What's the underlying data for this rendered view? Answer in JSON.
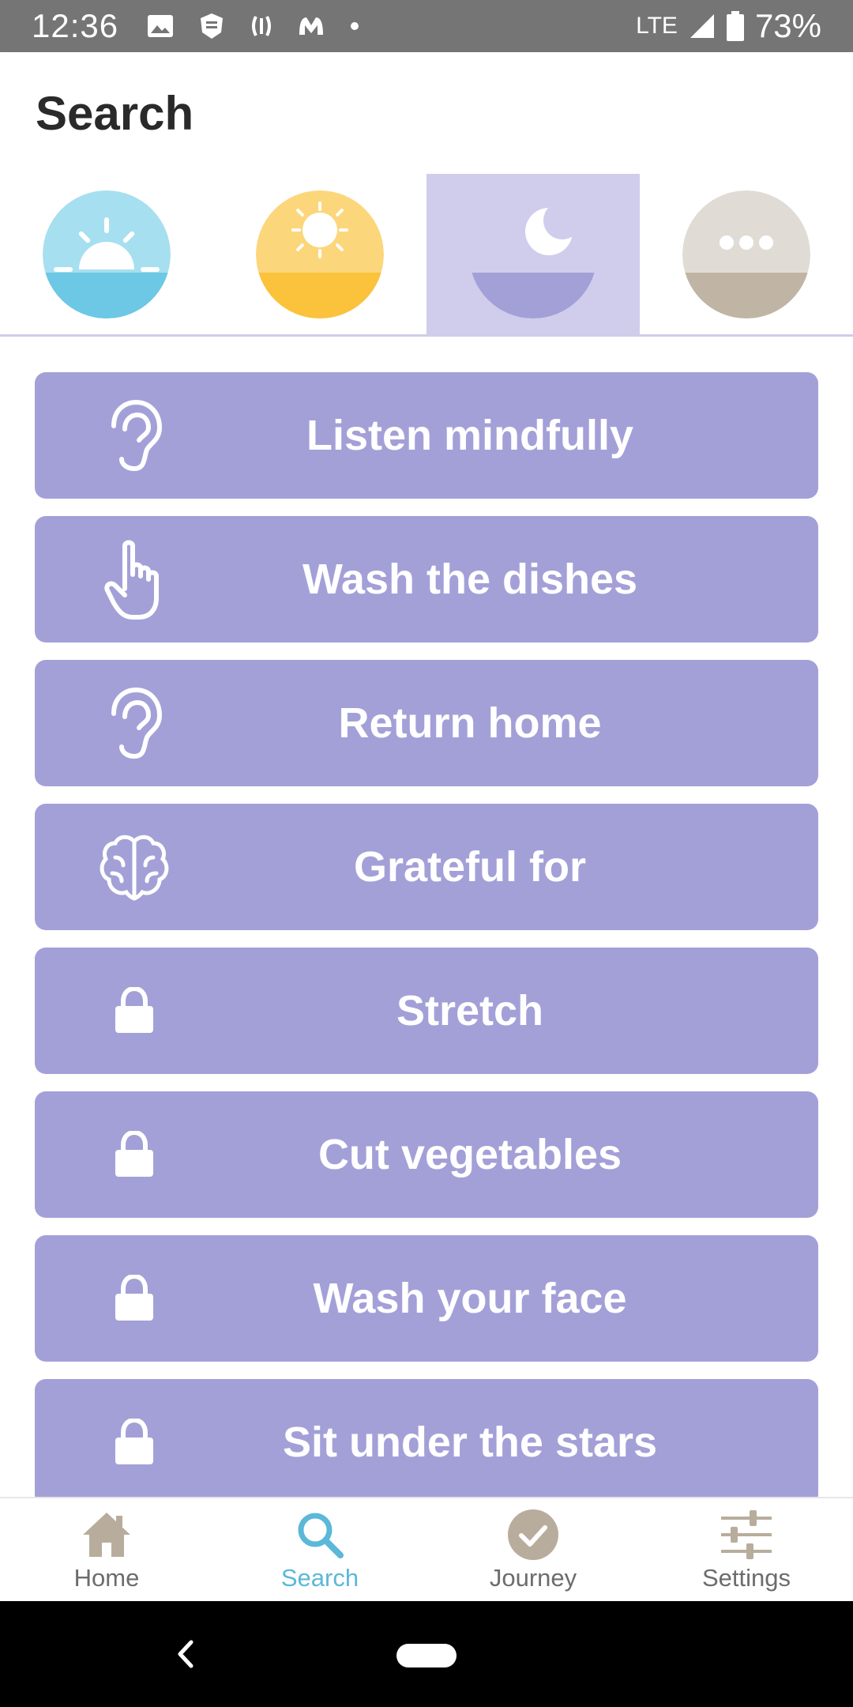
{
  "status_bar": {
    "time": "12:36",
    "network": "LTE",
    "battery": "73%"
  },
  "header": {
    "title": "Search"
  },
  "time_of_day_tabs": [
    {
      "icon": "sunrise-icon",
      "active": false
    },
    {
      "icon": "sun-icon",
      "active": false
    },
    {
      "icon": "moon-icon",
      "active": true
    },
    {
      "icon": "more-icon",
      "active": false
    }
  ],
  "activities": [
    {
      "label": "Listen mindfully",
      "icon": "ear-icon"
    },
    {
      "label": "Wash the dishes",
      "icon": "hand-pointer-icon"
    },
    {
      "label": "Return home",
      "icon": "ear-icon"
    },
    {
      "label": "Grateful for",
      "icon": "brain-icon"
    },
    {
      "label": "Stretch",
      "icon": "lock-icon"
    },
    {
      "label": "Cut vegetables",
      "icon": "lock-icon"
    },
    {
      "label": "Wash your face",
      "icon": "lock-icon"
    },
    {
      "label": "Sit under the stars",
      "icon": "lock-icon"
    }
  ],
  "bottom_nav": [
    {
      "label": "Home",
      "icon": "home-icon",
      "active": false
    },
    {
      "label": "Search",
      "icon": "search-icon",
      "active": true
    },
    {
      "label": "Journey",
      "icon": "check-circle-icon",
      "active": false
    },
    {
      "label": "Settings",
      "icon": "sliders-icon",
      "active": false
    }
  ],
  "colors": {
    "activity_bg": "#a3a0d8",
    "active_tab_bg": "#cfcdeb",
    "nav_active": "#5bb8d8",
    "nav_inactive_icon": "#b8ad9c"
  }
}
